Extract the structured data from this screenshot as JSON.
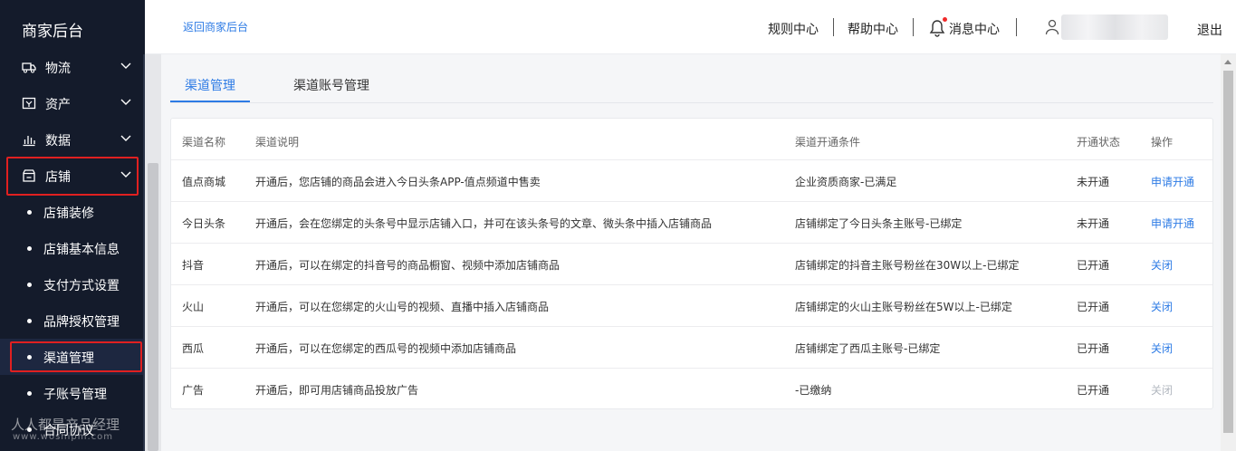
{
  "sidebar": {
    "brand": "商家后台",
    "groups": [
      {
        "label": "物流",
        "icon": "truck-icon"
      },
      {
        "label": "资产",
        "icon": "wallet-icon"
      },
      {
        "label": "数据",
        "icon": "bar-chart-icon"
      },
      {
        "label": "店铺",
        "icon": "store-icon"
      }
    ],
    "sub_items": [
      {
        "label": "店铺装修"
      },
      {
        "label": "店铺基本信息"
      },
      {
        "label": "支付方式设置"
      },
      {
        "label": "品牌授权管理"
      },
      {
        "label": "渠道管理"
      },
      {
        "label": "子账号管理"
      },
      {
        "label": "合同协议"
      }
    ]
  },
  "header": {
    "back_link": "返回商家后台",
    "nav": [
      "规则中心",
      "帮助中心",
      "消息中心"
    ],
    "logout": "退出"
  },
  "tabs": [
    {
      "label": "渠道管理",
      "active": true
    },
    {
      "label": "渠道账号管理",
      "active": false
    }
  ],
  "table": {
    "columns": [
      "渠道名称",
      "渠道说明",
      "渠道开通条件",
      "开通状态",
      "操作"
    ],
    "rows": [
      {
        "name": "值点商城",
        "desc": "开通后，您店铺的商品会进入今日头条APP-值点频道中售卖",
        "condition": "企业资质商家-已满足",
        "status": "未开通",
        "action": "申请开通",
        "action_enabled": true
      },
      {
        "name": "今日头条",
        "desc": "开通后，会在您绑定的头条号中显示店铺入口，并可在该头条号的文章、微头条中插入店铺商品",
        "condition": "店铺绑定了今日头条主账号-已绑定",
        "status": "未开通",
        "action": "申请开通",
        "action_enabled": true
      },
      {
        "name": "抖音",
        "desc": "开通后，可以在绑定的抖音号的商品橱窗、视频中添加店铺商品",
        "condition": "店铺绑定的抖音主账号粉丝在30W以上-已绑定",
        "status": "已开通",
        "action": "关闭",
        "action_enabled": true
      },
      {
        "name": "火山",
        "desc": "开通后，可以在您绑定的火山号的视频、直播中插入店铺商品",
        "condition": "店铺绑定的火山主账号粉丝在5W以上-已绑定",
        "status": "已开通",
        "action": "关闭",
        "action_enabled": true
      },
      {
        "name": "西瓜",
        "desc": "开通后，可以在您绑定的西瓜号的视频中添加店铺商品",
        "condition": "店铺绑定了西瓜主账号-已绑定",
        "status": "已开通",
        "action": "关闭",
        "action_enabled": true
      },
      {
        "name": "广告",
        "desc": "开通后，即可用店铺商品投放广告",
        "condition": "-已缴纳",
        "status": "已开通",
        "action": "关闭",
        "action_enabled": false
      }
    ]
  },
  "watermark": {
    "line1": "人人都是产品经理",
    "line2": "www.woshipm.com"
  },
  "colors": {
    "sidebar_bg": "#141b2b",
    "accent": "#2d7be5",
    "highlight_border": "#e02020",
    "badge_dot": "#f02a2a"
  }
}
